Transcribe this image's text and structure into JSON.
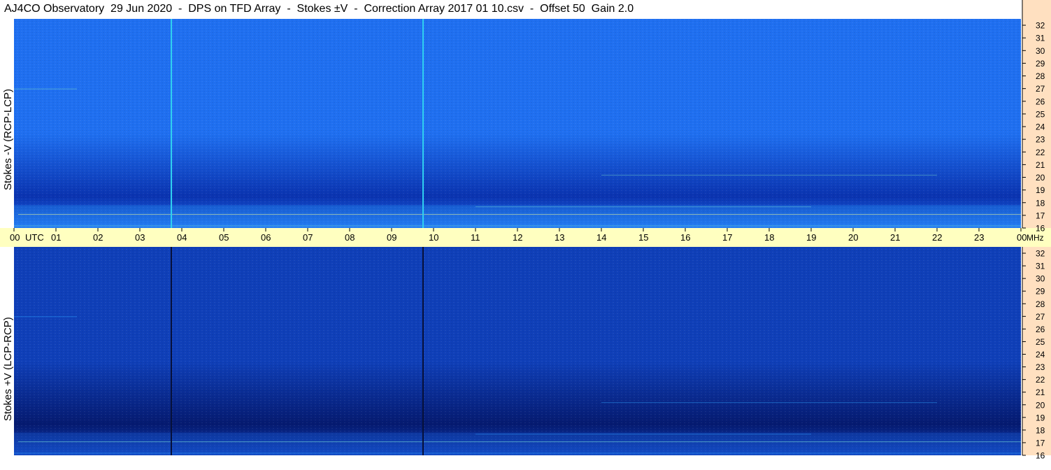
{
  "title": "AJ4CO Observatory  29 Jun 2020  -  DPS on TFD Array  -  Stokes ±V  -  Correction Array 2017 01 10.csv  -  Offset 50  Gain 2.0",
  "chart_data": [
    {
      "type": "heatmap",
      "panel": "top",
      "ylabel": "Stokes -V (RCP-LCP)",
      "yunit": "MHz",
      "y_ticks": [
        16,
        17,
        18,
        19,
        20,
        21,
        22,
        23,
        24,
        25,
        26,
        27,
        28,
        29,
        30,
        31,
        32
      ],
      "ylim": [
        16,
        32.5
      ],
      "x_ticks": [
        "00",
        "01",
        "02",
        "03",
        "04",
        "05",
        "06",
        "07",
        "08",
        "09",
        "10",
        "11",
        "12",
        "13",
        "14",
        "15",
        "16",
        "17",
        "18",
        "19",
        "20",
        "21",
        "22",
        "23",
        "00"
      ],
      "x_unit": "UTC",
      "colormap": [
        "#0a33b0",
        "#1f6ff0",
        "#2ea8ff",
        "#7fe0c8",
        "#f5f08a"
      ],
      "vertical_lines_utc": [
        3.75,
        9.75
      ],
      "vertical_line_color": "#2fd0f0"
    },
    {
      "type": "heatmap",
      "panel": "bottom",
      "ylabel": "Stokes +V (LCP-RCP)",
      "yunit": "MHz",
      "y_ticks": [
        16,
        17,
        18,
        19,
        20,
        21,
        22,
        23,
        24,
        25,
        26,
        27,
        28,
        29,
        30,
        31,
        32
      ],
      "ylim": [
        16,
        32.5
      ],
      "x_ticks": [
        "00",
        "01",
        "02",
        "03",
        "04",
        "05",
        "06",
        "07",
        "08",
        "09",
        "10",
        "11",
        "12",
        "13",
        "14",
        "15",
        "16",
        "17",
        "18",
        "19",
        "20",
        "21",
        "22",
        "23",
        "00"
      ],
      "x_unit": "UTC",
      "colormap": [
        "#051a70",
        "#0f3fb8",
        "#1f6ff0",
        "#2ea8ff",
        "#7fe0c8"
      ],
      "vertical_lines_utc": [
        3.75,
        9.75
      ],
      "vertical_line_color": "#06103a"
    }
  ],
  "axis_labels": {
    "utc": "UTC",
    "mhz": "MHz"
  },
  "colors": {
    "axis_band": "#ffffc0",
    "right_band": "#ffe0c0",
    "tick": "#000000"
  }
}
